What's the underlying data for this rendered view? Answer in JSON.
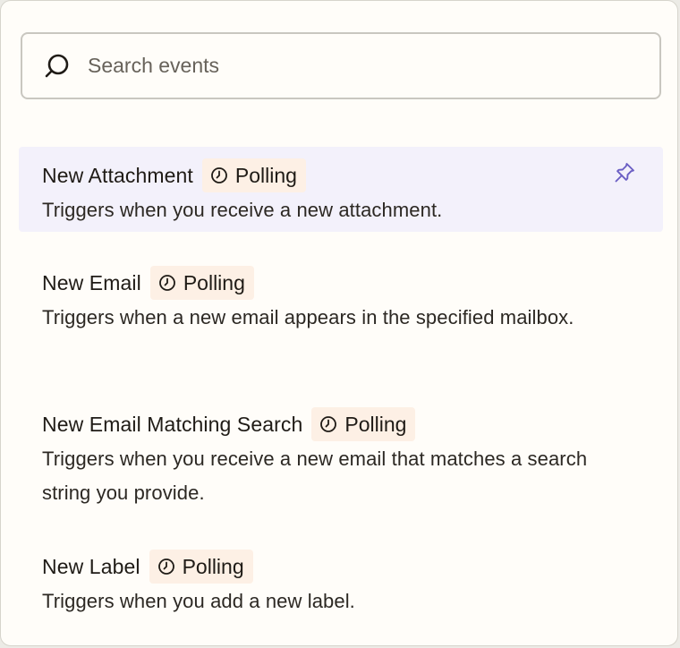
{
  "search": {
    "placeholder": "Search events",
    "value": "",
    "icon": "search-icon"
  },
  "colors": {
    "panel_bg": "#fffdf9",
    "selected_bg": "#f3f1fb",
    "badge_bg": "#fdf0e5",
    "pin_color": "#6b5fc4"
  },
  "events": [
    {
      "title": "New Attachment",
      "badge": "Polling",
      "badge_icon": "clock-icon",
      "description": "Triggers when you receive a new attachment.",
      "selected": true,
      "pin_icon": "pin-icon"
    },
    {
      "title": "New Email",
      "badge": "Polling",
      "badge_icon": "clock-icon",
      "description": "Triggers when a new email appears in the specified mailbox."
    },
    {
      "title": "New Email Matching Search",
      "badge": "Polling",
      "badge_icon": "clock-icon",
      "description": "Triggers when you receive a new email that matches a search string you provide."
    },
    {
      "title": "New Label",
      "badge": "Polling",
      "badge_icon": "clock-icon",
      "description": "Triggers when you add a new label."
    }
  ]
}
